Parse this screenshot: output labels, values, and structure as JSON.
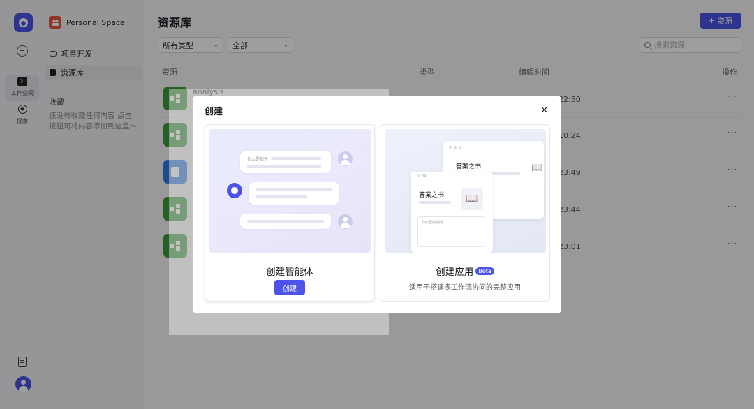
{
  "rail": {
    "workspace_label": "工作空间",
    "explore_label": "探索"
  },
  "sidebar": {
    "space_name": "Personal Space",
    "links": [
      {
        "label": "项目开发",
        "active": false
      },
      {
        "label": "资源库",
        "active": true
      }
    ],
    "favorites_title": "收藏",
    "favorites_empty": "还没有收藏任何内容 点击 按钮可将内容添加到这里～"
  },
  "main": {
    "title": "资源库",
    "add_button": "资源",
    "filters": {
      "type": "所有类型",
      "scope": "全部"
    },
    "search_placeholder": "搜索资源",
    "columns": {
      "resource": "资源",
      "type": "类型",
      "edit_time": "编辑时间",
      "actions": "操作"
    },
    "rows": [
      {
        "name": "analysis",
        "kind": "workflow",
        "time": "22:50"
      },
      {
        "name": "",
        "kind": "workflow",
        "time": "10:24"
      },
      {
        "name": "",
        "kind": "knowledge",
        "time": "23:49"
      },
      {
        "name": "",
        "kind": "workflow",
        "time": "23:44"
      },
      {
        "name": "",
        "kind": "workflow",
        "time": "23:01"
      }
    ],
    "more_glyph": "···"
  },
  "modal": {
    "title": "创建",
    "close_glyph": "×",
    "agent_card": {
      "title": "创建智能体",
      "button": "创建",
      "illus_question": "什么是扣子"
    },
    "app_card": {
      "title": "创建应用",
      "badge": "Beta",
      "description": "适用于搭建多工作流协同的完整应用",
      "illus_title_back": "答案之书",
      "illus_title_front": "答案之书",
      "illus_time": "10:09",
      "illus_input_hint": "你心里的疑问"
    }
  },
  "colors": {
    "brand": "#4d53e8",
    "workflow_green": "#3a9b3a",
    "knowledge_blue": "#2f7ce6",
    "space_orange": "#e5583b"
  }
}
